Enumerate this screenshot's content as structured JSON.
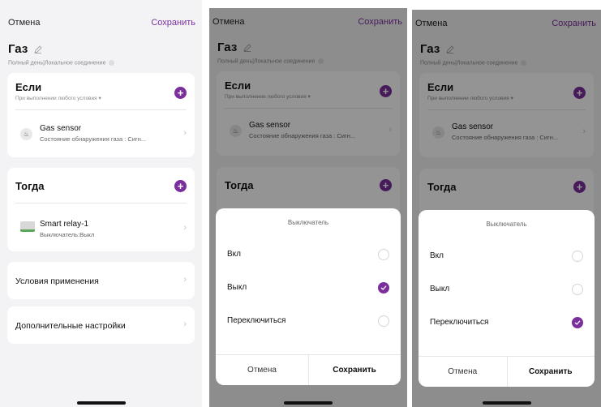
{
  "colors": {
    "accent": "#7b2f9c",
    "background": "#f3f3f5",
    "card": "#ffffff",
    "overlay": "rgba(0,0,0,0.42)"
  },
  "header": {
    "cancel": "Отмена",
    "save": "Сохранить"
  },
  "scene": {
    "title": "Газ",
    "subtitle": "Полный день|Локальное соединение",
    "edit_icon": "pencil-icon",
    "info_icon": "info-icon"
  },
  "if_card": {
    "title": "Если",
    "subtitle": "При выполнении любого условия",
    "add_icon": "plus-icon",
    "condition": {
      "name": "Gas sensor",
      "state": "Состояние обнаружения газа : Сигн...",
      "icon": "flame-icon"
    }
  },
  "then_card": {
    "title": "Тогда",
    "add_icon": "plus-icon",
    "action": {
      "name": "Smart relay-1",
      "state": "Выключатель:Выкл",
      "icon": "relay-icon"
    }
  },
  "rows": {
    "conditions": "Условия применения",
    "advanced": "Дополнительные настройки"
  },
  "sheet": {
    "title": "Выключатель",
    "options": [
      "Вкл",
      "Выкл",
      "Переключиться"
    ],
    "cancel": "Отмена",
    "save": "Сохранить"
  },
  "screens": [
    {
      "id": "main",
      "selected_option": null
    },
    {
      "id": "sheet-off",
      "selected_option": "Выкл"
    },
    {
      "id": "sheet-toggle",
      "selected_option": "Переключиться"
    }
  ]
}
